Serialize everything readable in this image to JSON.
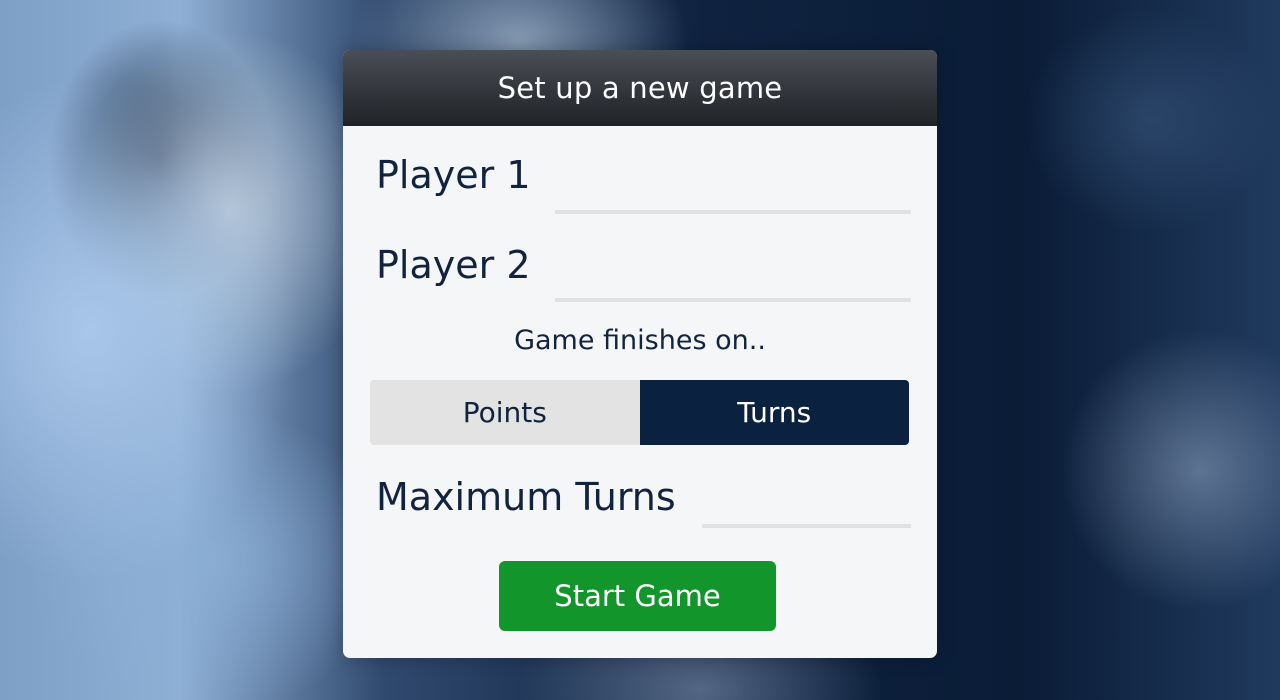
{
  "dialog": {
    "title": "Set up a new game",
    "player1": {
      "label": "Player 1",
      "value": ""
    },
    "player2": {
      "label": "Player 2",
      "value": ""
    },
    "finish": {
      "label": "Game finishes on..",
      "options": [
        "Points",
        "Turns"
      ],
      "selected": "Turns"
    },
    "max_turns": {
      "label": "Maximum Turns",
      "value": ""
    },
    "start_button": "Start Game"
  },
  "colors": {
    "header": "#2a2d32",
    "panel": "#f5f6f8",
    "text": "#12233d",
    "toggle_selected": "#0b2140",
    "toggle_unselected": "#e3e3e4",
    "start_button": "#12952a"
  }
}
